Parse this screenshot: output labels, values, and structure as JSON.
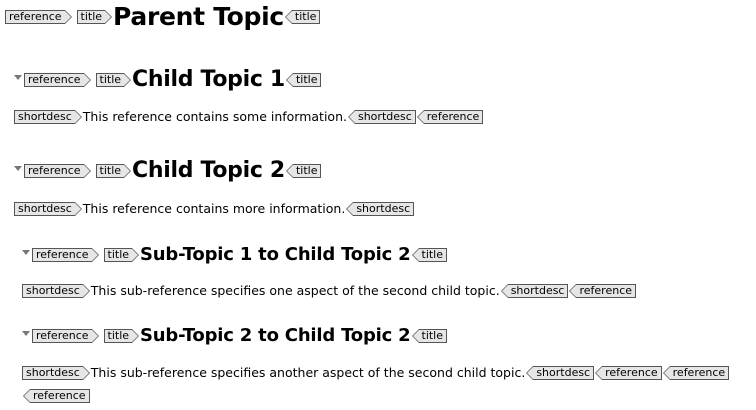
{
  "tags": {
    "reference": "reference",
    "title": "title",
    "shortdesc": "shortdesc"
  },
  "parent": {
    "title": "Parent Topic"
  },
  "child1": {
    "title": "Child Topic 1",
    "shortdesc": "This reference contains some information."
  },
  "child2": {
    "title": "Child Topic 2",
    "shortdesc": "This reference contains more information."
  },
  "sub1": {
    "title": "Sub-Topic 1 to Child Topic 2",
    "shortdesc": "This sub-reference specifies one aspect of the second child topic."
  },
  "sub2": {
    "title": "Sub-Topic 2 to Child Topic 2",
    "shortdesc": "This sub-reference specifies another aspect of the second child topic."
  },
  "icons": {
    "collapse": "collapse-triangle-icon"
  },
  "colors": {
    "tag_fill": "#e6e6e6",
    "tag_border": "#555555",
    "twisty": "#777777"
  }
}
